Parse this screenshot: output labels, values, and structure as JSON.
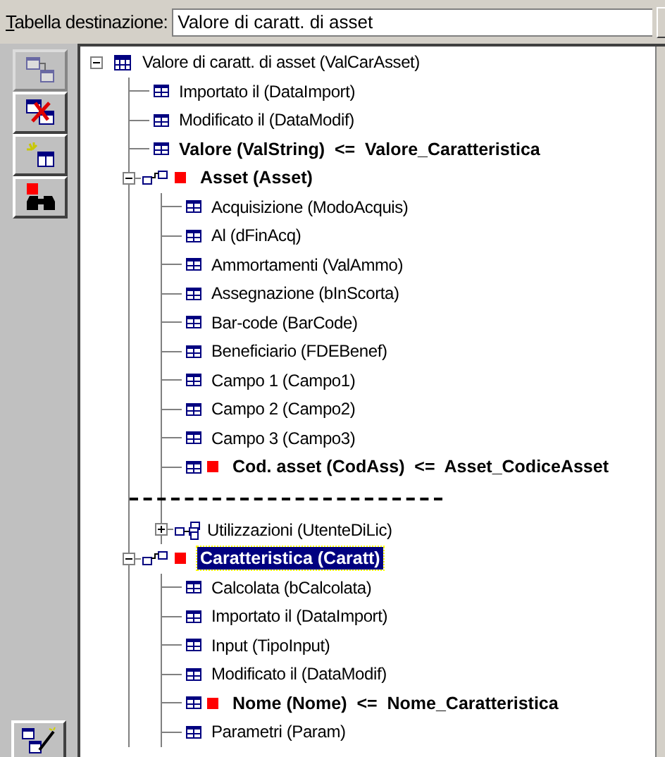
{
  "header": {
    "label": "Tabella destinazione:",
    "value": "Valore di caratt. di asset"
  },
  "toolbar": [
    {
      "kind": "link-tables",
      "disabled": true
    },
    {
      "kind": "delete-table",
      "disabled": false
    },
    {
      "kind": "new-table",
      "disabled": false
    },
    {
      "kind": "find",
      "disabled": false
    }
  ],
  "tree": {
    "kind": "table",
    "label": "Valore di caratt. di asset (ValCarAsset)",
    "bold": false,
    "key": false,
    "selected": false,
    "expanded": true,
    "children": [
      {
        "kind": "field",
        "label": "Importato il (DataImport)",
        "bold": false,
        "key": false,
        "selected": false
      },
      {
        "kind": "field",
        "label": "Modificato il (DataModif)",
        "bold": false,
        "key": false,
        "selected": false
      },
      {
        "kind": "field",
        "label": "Valore (ValString)  <=  Valore_Caratteristica",
        "bold": true,
        "key": false,
        "selected": false
      },
      {
        "kind": "link",
        "label": "Asset (Asset)",
        "bold": true,
        "key": true,
        "selected": false,
        "expanded": true,
        "children": [
          {
            "kind": "field",
            "label": "Acquisizione (ModoAcquis)",
            "bold": false,
            "key": false,
            "selected": false
          },
          {
            "kind": "field",
            "label": "Al (dFinAcq)",
            "bold": false,
            "key": false,
            "selected": false
          },
          {
            "kind": "field",
            "label": "Ammortamenti (ValAmmo)",
            "bold": false,
            "key": false,
            "selected": false
          },
          {
            "kind": "field",
            "label": "Assegnazione (bInScorta)",
            "bold": false,
            "key": false,
            "selected": false
          },
          {
            "kind": "field",
            "label": "Bar-code (BarCode)",
            "bold": false,
            "key": false,
            "selected": false
          },
          {
            "kind": "field",
            "label": "Beneficiario (FDEBenef)",
            "bold": false,
            "key": false,
            "selected": false
          },
          {
            "kind": "field",
            "label": "Campo 1 (Campo1)",
            "bold": false,
            "key": false,
            "selected": false
          },
          {
            "kind": "field",
            "label": "Campo 2 (Campo2)",
            "bold": false,
            "key": false,
            "selected": false
          },
          {
            "kind": "field",
            "label": "Campo 3 (Campo3)",
            "bold": false,
            "key": false,
            "selected": false
          },
          {
            "kind": "field",
            "label": "Cod. asset (CodAss)  <=  Asset_CodiceAsset",
            "bold": true,
            "key": true,
            "selected": false
          },
          {
            "kind": "separator"
          },
          {
            "kind": "multi-link",
            "label": "Utilizzazioni (UtenteDiLic)",
            "bold": false,
            "key": false,
            "selected": false,
            "expanded": false
          }
        ]
      },
      {
        "kind": "link",
        "label": "Caratteristica (Caratt)",
        "bold": true,
        "key": true,
        "selected": true,
        "expanded": true,
        "children": [
          {
            "kind": "field",
            "label": "Calcolata (bCalcolata)",
            "bold": false,
            "key": false,
            "selected": false
          },
          {
            "kind": "field",
            "label": "Importato il (DataImport)",
            "bold": false,
            "key": false,
            "selected": false
          },
          {
            "kind": "field",
            "label": "Input (TipoInput)",
            "bold": false,
            "key": false,
            "selected": false
          },
          {
            "kind": "field",
            "label": "Modificato il (DataModif)",
            "bold": false,
            "key": false,
            "selected": false
          },
          {
            "kind": "field",
            "label": "Nome (Nome)  <=  Nome_Caratteristica",
            "bold": true,
            "key": true,
            "selected": false
          },
          {
            "kind": "field",
            "label": "Parametri (Param)",
            "bold": false,
            "key": false,
            "selected": false
          }
        ]
      }
    ]
  }
}
